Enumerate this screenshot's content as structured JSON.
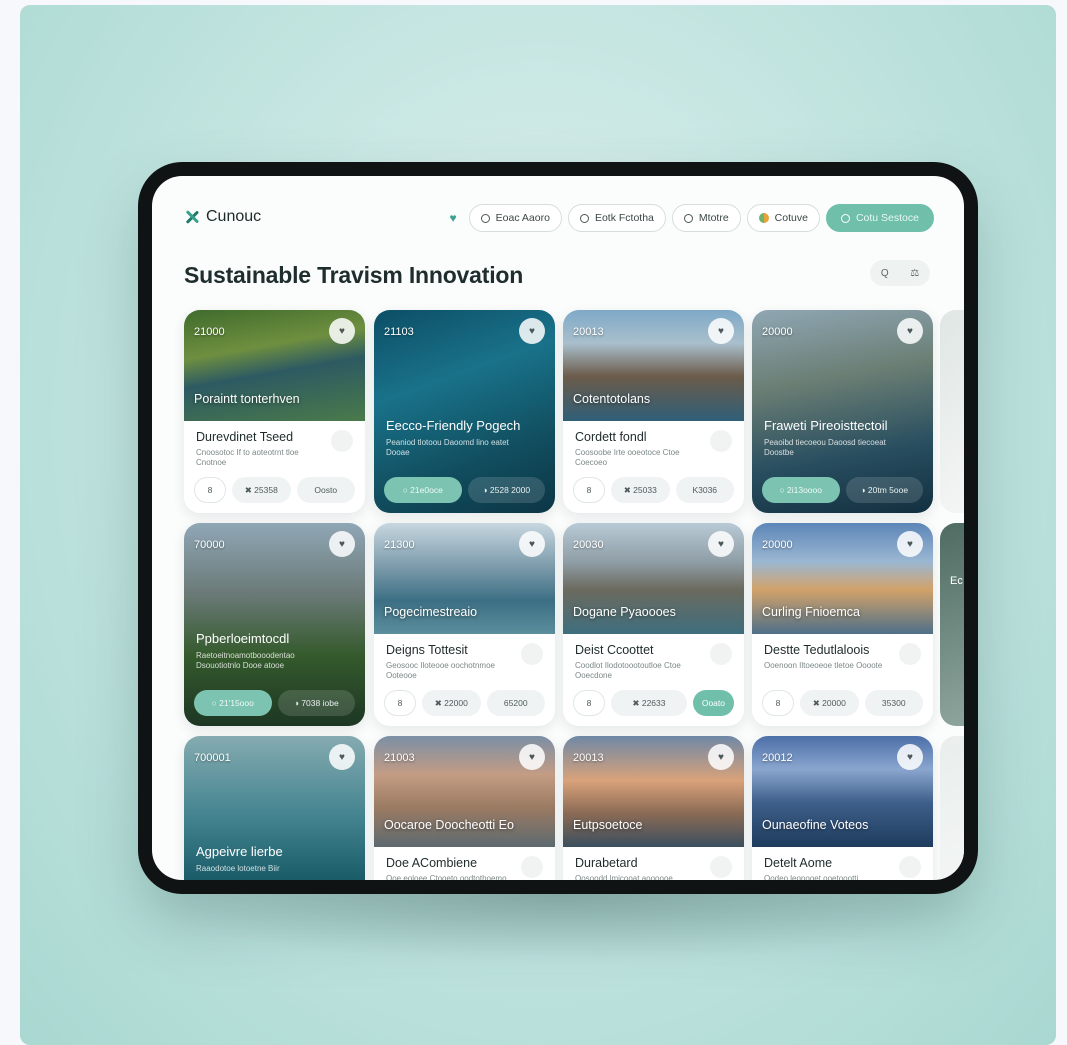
{
  "app": {
    "brand": "Cunouc",
    "page_title": "Sustainable Travism Innovation"
  },
  "nav": [
    {
      "label": "Eoac  Aaoro",
      "icon": "search-icon"
    },
    {
      "label": "Eotk  Fctotha",
      "icon": "circle-icon"
    },
    {
      "label": "Mtotre",
      "icon": "circle-icon"
    },
    {
      "label": "Cotuve",
      "icon": "globe-icon"
    },
    {
      "label": "Cotu Sestoce",
      "icon": "location-icon"
    }
  ],
  "tools": [
    "Q",
    "⚖"
  ],
  "cards": [
    {
      "code": "21000",
      "overlay": "Poraintt tonterhven",
      "name": "Durevdinet Tseed",
      "desc": "Cnoosotoc If to aoteotrnt tloe Cnotnoe",
      "chips": [
        "8",
        "✖ 25358",
        "Oosto"
      ],
      "variant": "a",
      "theme": "forest"
    },
    {
      "code": "21103",
      "overlay": "",
      "name": "Eecco-Friendly Pogech",
      "desc": "Peaniod tlotoou Daoomd lino eatet Dooae",
      "chips": [
        "○ 21e0oce",
        "◑ 2528 2000"
      ],
      "variant": "full",
      "theme": "ocean"
    },
    {
      "code": "20013",
      "overlay": "Cotentotolans",
      "name": "Cordett fondl",
      "desc": "Coosoobe Irte ooeotoce Ctoe Coecoeo",
      "chips": [
        "8",
        "✖ 25033",
        "K3036"
      ],
      "variant": "a",
      "theme": "mountain"
    },
    {
      "code": "20000",
      "overlay": "",
      "name": "Fraweti Pireoisttectoil",
      "desc": "Peaoibd tiecoeou Daoosd tiecoeat Doostbe",
      "chips": [
        "○ 2i13oooo",
        "◑ 20tm 5ooe"
      ],
      "variant": "full",
      "theme": "cliff"
    },
    {
      "code": "70000",
      "overlay": "",
      "name": "Ppberloeimtocdl",
      "desc": "Raetoeitnoamotbooodentao Dsouotiotnlo Dooe atooe",
      "chips": [
        "○ 21'15ooo",
        "◑ 7038 iobe"
      ],
      "variant": "full",
      "theme": "temple"
    },
    {
      "code": "21300",
      "overlay": "Pogecimestreaio",
      "name": "Deigns Tottesit",
      "desc": "Geosooc Iloteooe oochotnmoe Ooteooe",
      "chips": [
        "8",
        "✖ 22000",
        "65200"
      ],
      "variant": "a",
      "theme": "coast"
    },
    {
      "code": "20030",
      "overlay": "Dogane Pyaoooes",
      "name": "Deist Ccoottet",
      "desc": "Coodlot Ilodotoootoutloe Ctoe Ooecdone",
      "chips": [
        "8",
        "✖ 22633",
        "Ooato"
      ],
      "variant": "b",
      "theme": "harbor"
    },
    {
      "code": "20000",
      "overlay": "Curling Fnioemca",
      "name": "Destte Tedutlaloois",
      "desc": "Ooenoon Iltoeoeoe tletoe Oooote",
      "chips": [
        "8",
        "✖ 20000",
        "35300"
      ],
      "variant": "a",
      "theme": "castle"
    },
    {
      "code": "700001",
      "overlay": "",
      "name": "Agpeivre lierbe",
      "desc": "Raaodotoe lotoetne Biir",
      "chips": [],
      "variant": "full",
      "theme": "sea"
    },
    {
      "code": "21003",
      "overlay": "Oocaroe Doocheotti Eo",
      "name": "Doe ACombiene",
      "desc": "Ooe eoloee Ctooeto oodtothoemo",
      "chips": [],
      "variant": "a",
      "theme": "town"
    },
    {
      "code": "20013",
      "overlay": "Eutpsoetoce",
      "name": "Durabetard",
      "desc": "Oosoodd lmicooat aoooooe",
      "chips": [],
      "variant": "a",
      "theme": "sunset"
    },
    {
      "code": "20012",
      "overlay": "Ounaeofine Voteos",
      "name": "Detelt Aome",
      "desc": "Oodeo leonooet ooetoootti",
      "chips": [],
      "variant": "a",
      "theme": "bay"
    }
  ],
  "edge_label": "Ec"
}
